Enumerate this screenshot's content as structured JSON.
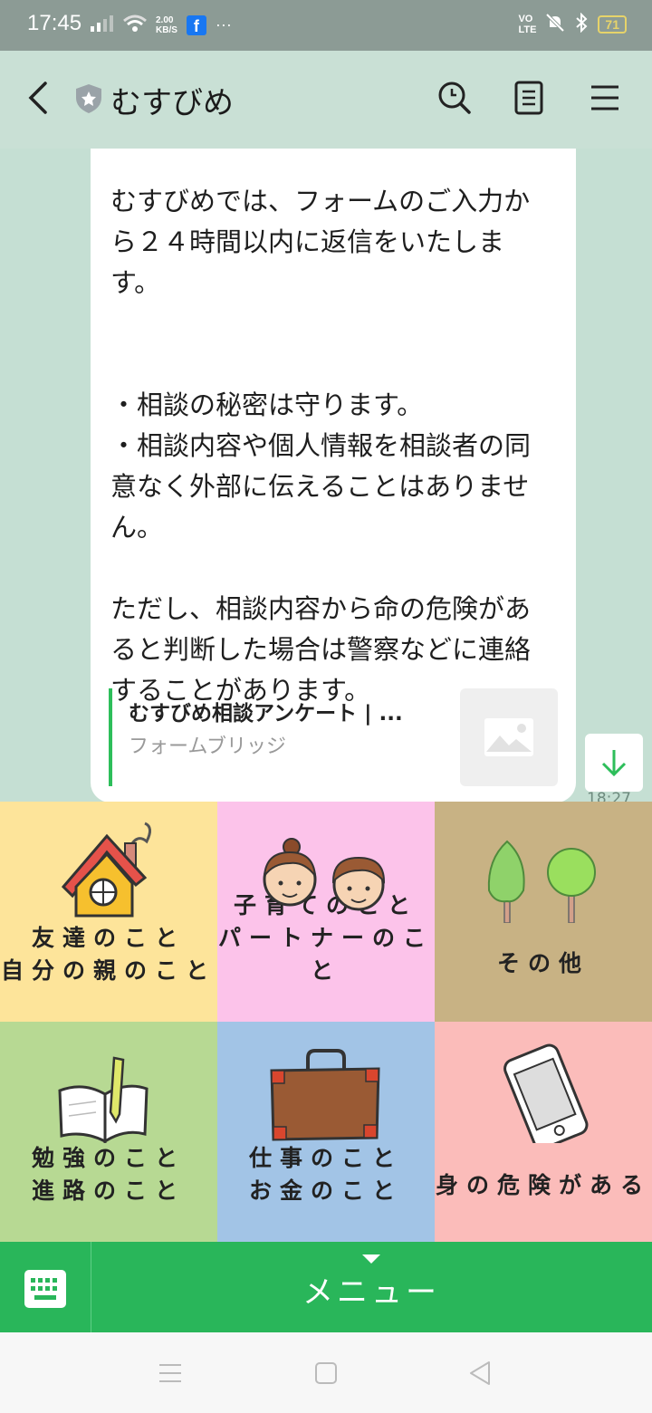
{
  "status": {
    "time": "17:45",
    "net_speed": "2.00\nKB/S",
    "fb": "f",
    "dots": "···",
    "volte": "VO\nLTE",
    "battery": "71"
  },
  "header": {
    "title": "むすびめ"
  },
  "message": {
    "text": "むすびめでは、フォームのご入力から２４時間以内に返信をいたします。\n\n\n・相談の秘密は守ります。\n・相談内容や個人情報を相談者の同意なく外部に伝えることはありません。\n\nただし、相談内容から命の危険があると判断した場合は警察などに連絡することがあります。",
    "link_title": "むすびめ相談アンケート | ...",
    "link_source": "フォームブリッジ",
    "time": "18:27"
  },
  "menu": {
    "items": [
      {
        "label": "友達のこと\n自分の親のこと",
        "icon": "house-icon",
        "bg": "#fde49a"
      },
      {
        "label": "子育てのこと\nパートナーのこと",
        "icon": "two-faces-icon",
        "bg": "#fcc3ea"
      },
      {
        "label": "その他",
        "icon": "trees-icon",
        "bg": "#c8b284"
      },
      {
        "label": "勉強のこと\n進路のこと",
        "icon": "notebook-pencil-icon",
        "bg": "#b7d993"
      },
      {
        "label": "仕事のこと\nお金のこと",
        "icon": "briefcase-icon",
        "bg": "#a2c4e6"
      },
      {
        "label": "身の危険がある",
        "icon": "smartphone-icon",
        "bg": "#fbbcba"
      }
    ],
    "bar_label": "メニュー",
    "bar_color": "#29b65a"
  }
}
